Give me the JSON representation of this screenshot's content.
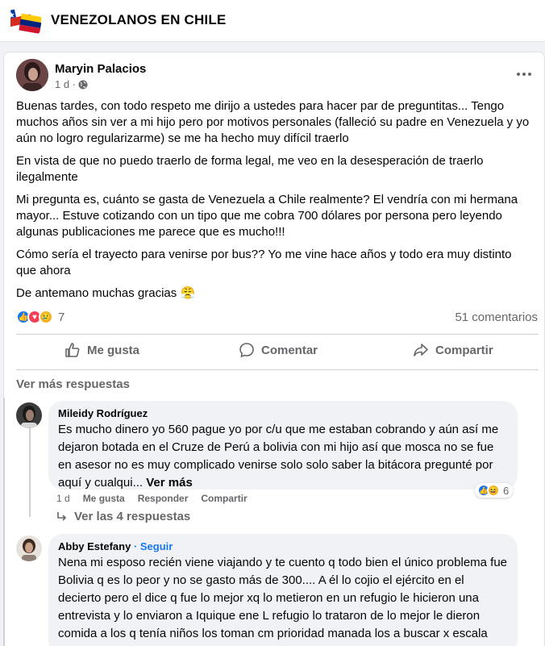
{
  "group": {
    "title": "VENEZOLANOS EN CHILE",
    "flag_colors": {
      "chile_red": "#d52b1e",
      "chile_blue": "#0039a6",
      "ven_yellow": "#ffcc00",
      "ven_blue": "#00247d",
      "ven_red": "#cf142b"
    }
  },
  "post": {
    "author": "Maryin Palacios",
    "time": "1 d ·",
    "privacy_icon": "globe-icon",
    "paragraphs": [
      "Buenas tardes, con todo respeto me dirijo a ustedes para hacer par de preguntitas... Tengo muchos años sin ver a mi hijo pero por motivos personales (falleció su padre en Venezuela y yo aún no logro regularizarme) se me ha hecho muy difícil traerlo",
      "En vista de que no puedo traerlo de forma legal, me veo en la desesperación de traerlo ilegalmente",
      "Mi pregunta es, cuánto se gasta de Venezuela a Chile realmente? El vendría con mi hermana mayor... Estuve cotizando con un tipo que me cobra 700 dólares por persona pero leyendo algunas publicaciones me parece que es mucho!!!",
      "Cómo sería el trayecto para venirse por bus?? Yo me vine hace años y todo era muy distinto que ahora",
      "De antemano muchas gracias 😤"
    ],
    "reaction_count": "7",
    "comments_count": "51 comentarios",
    "actions": {
      "like": "Me gusta",
      "comment": "Comentar",
      "share": "Compartir"
    }
  },
  "see_more_replies": "Ver más respuestas",
  "comments": [
    {
      "name": "Mileidy Rodríguez",
      "text": "Es mucho dinero yo 560 pague yo por c/u que me estaban cobrando y aún así me dejaron botada en el Cruze de Perú a bolivia con mi hijo así que mosca no se fue en asesor no es muy complicado venirse solo solo saber la bitácora pregunté por aquí y cualqui...",
      "see_more": "Ver más",
      "time": "1 d",
      "like": "Me gusta",
      "reply": "Responder",
      "share": "Compartir",
      "reaction_count": "6",
      "view_replies": "Ver las 4 respuestas"
    },
    {
      "name": "Abby Estefany",
      "follow": "· Seguir",
      "text": "Nena mi esposo recién viene viajando y te cuento q todo bien el único problema fue Bolivia q es lo peor y no se gasto más de 300.... A él lo cojio el ejército en el decierto pero el dice q fue lo mejor xq lo metieron en un refugio le hicieron una entrevista y lo enviaron a Iquique ene L refugio lo trataron de lo mejor le dieron comida a los q tenía niños los toman cm prioridad manada los a buscar x escala sales mejor y q se entreguen en Bolivia le regalan los paisajes cuando tienen niño"
    }
  ]
}
